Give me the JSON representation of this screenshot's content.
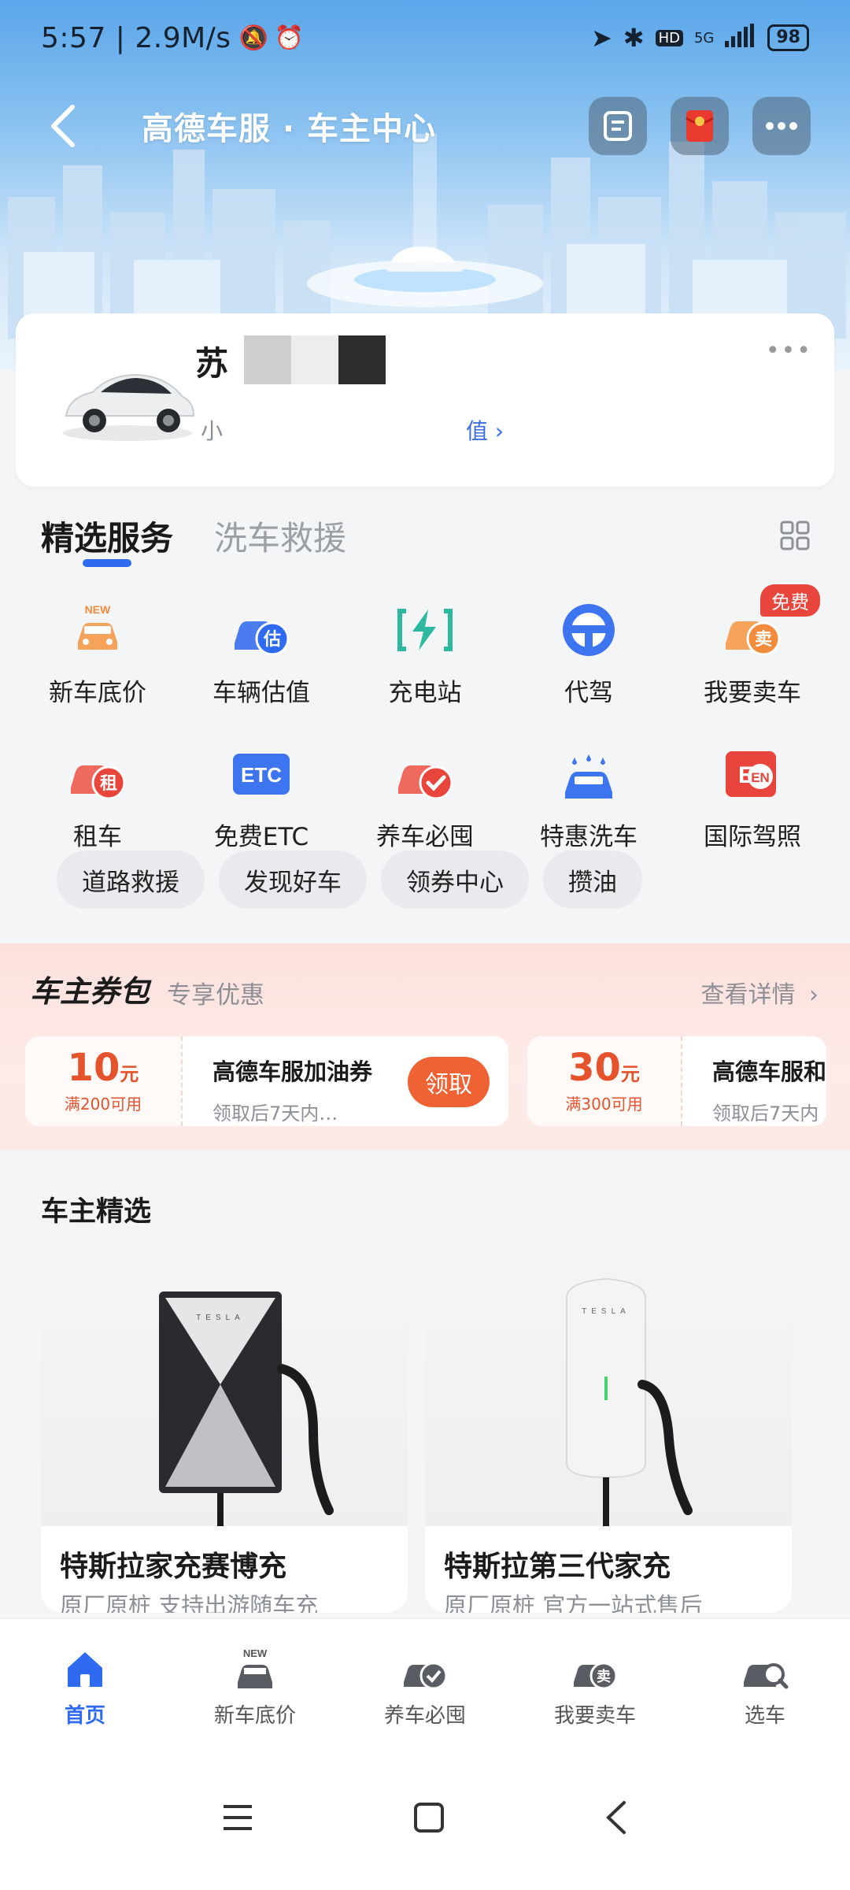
{
  "status_bar": {
    "time": "5:57 | 2.9M/s",
    "network": "5G",
    "battery": "98"
  },
  "header": {
    "title": "高德车服 · 车主中心"
  },
  "vehicle": {
    "name": "苏",
    "subtitle": "小",
    "link": "值 ›"
  },
  "services": {
    "tabs": [
      "精选服务",
      "洗车救援"
    ],
    "items": [
      {
        "label": "新车底价",
        "icon": "new-car-icon"
      },
      {
        "label": "车辆估值",
        "icon": "valuation-icon"
      },
      {
        "label": "充电站",
        "icon": "charging-icon"
      },
      {
        "label": "代驾",
        "icon": "steering-wheel-icon"
      },
      {
        "label": "我要卖车",
        "icon": "sell-car-icon",
        "badge": "免费"
      },
      {
        "label": "租车",
        "icon": "rent-car-icon"
      },
      {
        "label": "免费ETC",
        "icon": "etc-icon"
      },
      {
        "label": "养车必囤",
        "icon": "maintenance-icon"
      },
      {
        "label": "特惠洗车",
        "icon": "car-wash-icon"
      },
      {
        "label": "国际驾照",
        "icon": "intl-license-icon"
      }
    ],
    "chips": [
      "道路救援",
      "发现好车",
      "领券中心",
      "攒油"
    ]
  },
  "coupons": {
    "title": "车主券包",
    "subtitle": "专享优惠",
    "more": "查看详情",
    "list": [
      {
        "amount": "10",
        "unit": "元",
        "condition": "满200可用",
        "name": "高德车服加油券",
        "desc": "领取后7天内…",
        "button": "领取"
      },
      {
        "amount": "30",
        "unit": "元",
        "condition": "满300可用",
        "name": "高德车服和",
        "desc": "领取后7天内"
      }
    ]
  },
  "selection": {
    "title": "车主精选",
    "products": [
      {
        "name": "特斯拉家充赛博充",
        "desc": "原厂原桩 支持出游随车充"
      },
      {
        "name": "特斯拉第三代家充",
        "desc": "原厂原桩 官方一站式售后"
      }
    ]
  },
  "bottom_nav": [
    {
      "label": "首页",
      "icon": "home-icon",
      "active": true
    },
    {
      "label": "新车底价",
      "icon": "new-car-icon"
    },
    {
      "label": "养车必囤",
      "icon": "maintenance-icon"
    },
    {
      "label": "我要卖车",
      "icon": "sell-car-icon"
    },
    {
      "label": "选车",
      "icon": "car-search-icon"
    }
  ],
  "colors": {
    "accent": "#2f6bf0",
    "orange": "#f28b3c",
    "red": "#e8453c",
    "coupon": "#e5532d"
  }
}
